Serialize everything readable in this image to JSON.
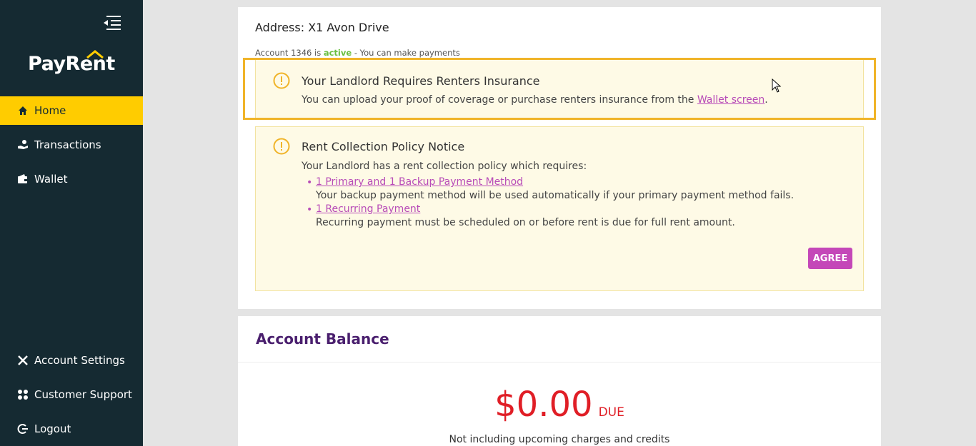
{
  "brand": {
    "logo_text": "PayRent"
  },
  "sidebar": {
    "top_items": [
      {
        "label": "Home",
        "icon": "home-icon",
        "active": true
      },
      {
        "label": "Transactions",
        "icon": "hand-coin-icon",
        "active": false
      },
      {
        "label": "Wallet",
        "icon": "wallet-icon",
        "active": false
      }
    ],
    "bottom_items": [
      {
        "label": "Account Settings",
        "icon": "tools-icon"
      },
      {
        "label": "Customer Support",
        "icon": "support-icon"
      },
      {
        "label": "Logout",
        "icon": "logout-icon"
      }
    ]
  },
  "account": {
    "address": "Address: X1 Avon Drive",
    "status_prefix": "Account 1346 is ",
    "status_word": "active",
    "status_suffix": " - You can make payments"
  },
  "insurance_alert": {
    "title": "Your Landlord Requires Renters Insurance",
    "body_prefix": "You can upload your proof of coverage or purchase renters insurance from the ",
    "link_text": "Wallet screen",
    "body_suffix": "."
  },
  "policy_alert": {
    "title": "Rent Collection Policy Notice",
    "intro": "Your Landlord has a rent collection policy which requires:",
    "requirements": [
      {
        "link": "1 Primary and 1 Backup Payment Method",
        "desc": "Your backup payment method will be used automatically if your primary payment method fails."
      },
      {
        "link": "1 Recurring Payment",
        "desc": "Recurring payment must be scheduled on or before rent is due for full rent amount."
      }
    ],
    "agree_label": "AGREE"
  },
  "balance": {
    "title": "Account Balance",
    "amount": "$0.00",
    "due_label": "DUE",
    "note": "Not including upcoming charges and credits"
  },
  "colors": {
    "sidebar_bg": "#152a32",
    "active_nav": "#ffcc00",
    "accent_purple": "#c447b8",
    "title_purple": "#4a1f6e",
    "amount_red": "#e01e26",
    "active_green": "#6abf40",
    "highlight_orange": "#f0b429"
  }
}
